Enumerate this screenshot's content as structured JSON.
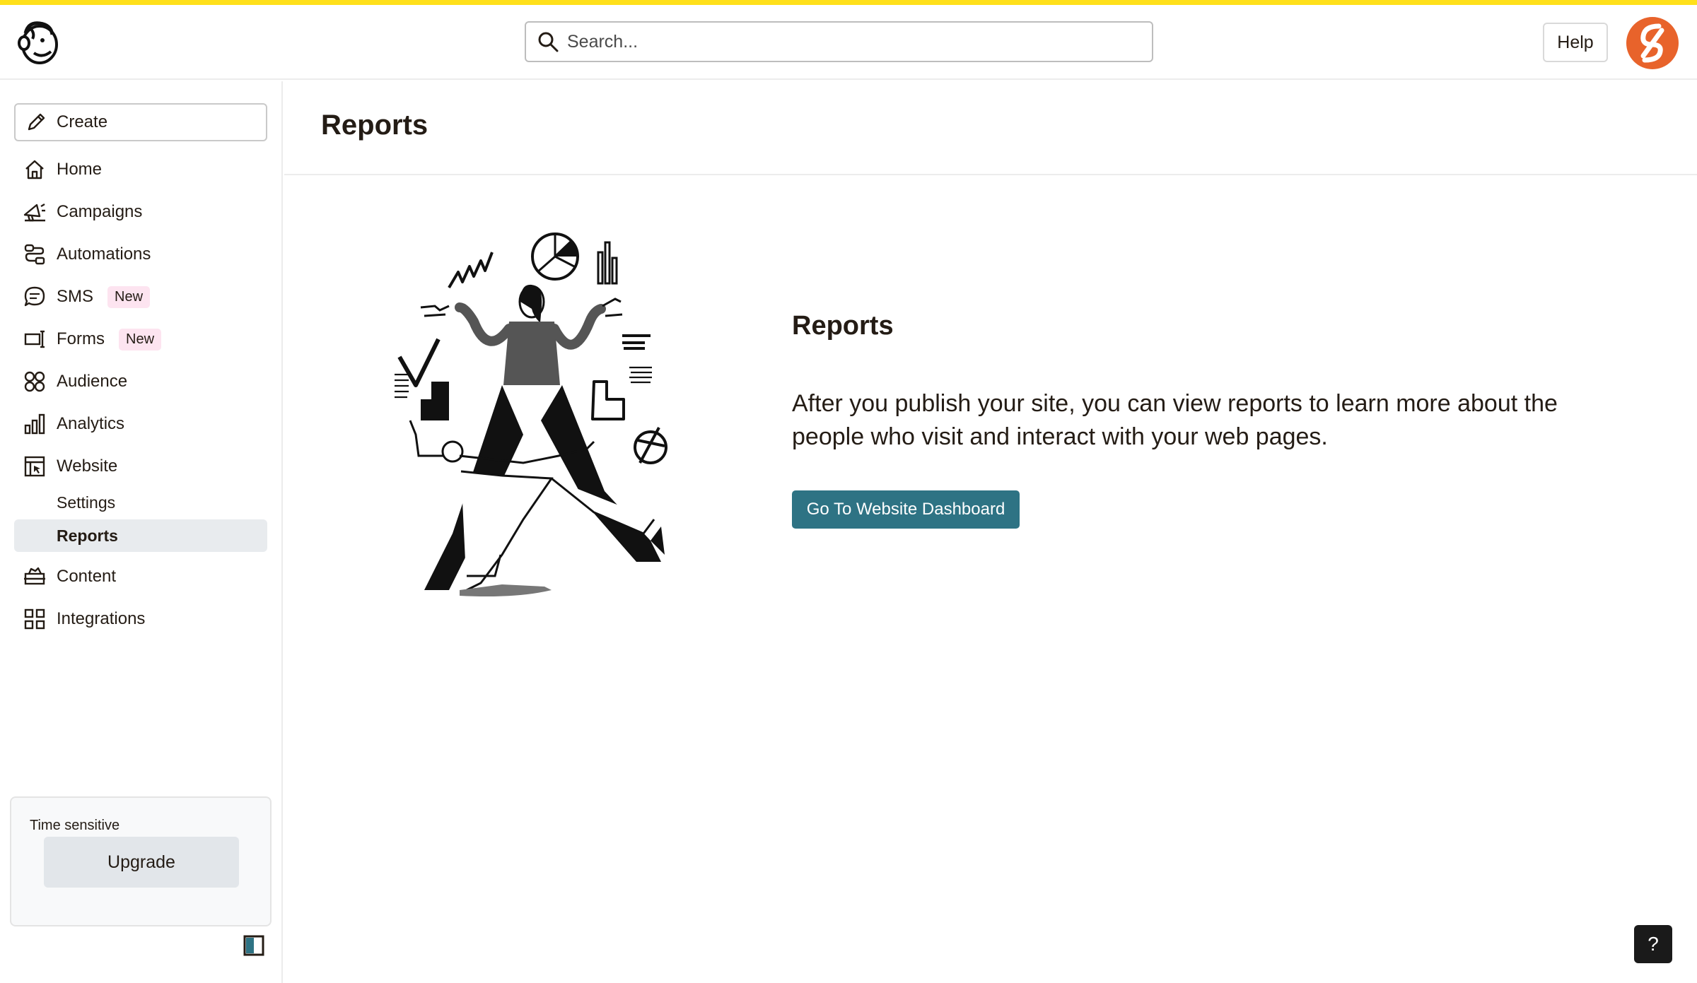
{
  "header": {
    "search_placeholder": "Search...",
    "help_label": "Help"
  },
  "sidebar": {
    "create_label": "Create",
    "items": [
      {
        "label": "Home",
        "icon": "home-icon"
      },
      {
        "label": "Campaigns",
        "icon": "megaphone-icon"
      },
      {
        "label": "Automations",
        "icon": "automation-icon"
      },
      {
        "label": "SMS",
        "icon": "chat-icon",
        "badge": "New"
      },
      {
        "label": "Forms",
        "icon": "form-icon",
        "badge": "New"
      },
      {
        "label": "Audience",
        "icon": "audience-icon"
      },
      {
        "label": "Analytics",
        "icon": "bar-chart-icon"
      },
      {
        "label": "Website",
        "icon": "website-icon"
      },
      {
        "label": "Content",
        "icon": "content-icon"
      },
      {
        "label": "Integrations",
        "icon": "grid-icon"
      }
    ],
    "website_sub": [
      {
        "label": "Settings",
        "active": false
      },
      {
        "label": "Reports",
        "active": true
      }
    ],
    "upgrade_card": {
      "caption": "Time sensitive",
      "button_label": "Upgrade"
    }
  },
  "page": {
    "title": "Reports"
  },
  "content": {
    "heading": "Reports",
    "description": "After you publish your site, you can view reports to learn more about the people who visit and interact with your web pages.",
    "button_label": "Go To Website Dashboard"
  },
  "float_help_label": "?",
  "colors": {
    "accent_stripe": "#ffe01b",
    "primary_button": "#2e7384",
    "badge_bg": "#fde4f0",
    "avatar": "#e8632b",
    "active_nav_bg": "#e8ebee"
  }
}
